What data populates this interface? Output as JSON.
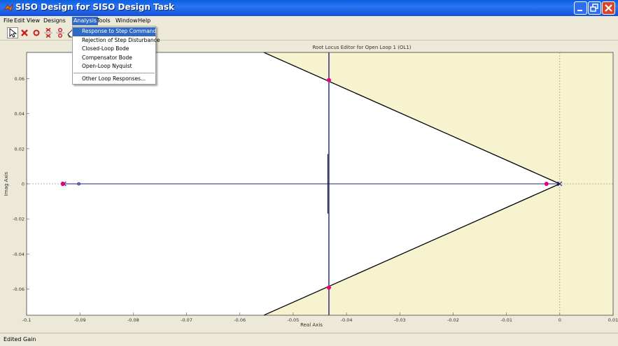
{
  "window": {
    "title": "SISO Design for SISO Design Task",
    "controls": [
      "minimize",
      "maximize",
      "close"
    ]
  },
  "menubar": {
    "items": [
      {
        "label": "File"
      },
      {
        "label": "Edit"
      },
      {
        "label": "View"
      },
      {
        "label": "Designs"
      },
      {
        "label": "Analysis",
        "active": true
      },
      {
        "label": "Tools"
      },
      {
        "label": "Window"
      },
      {
        "label": "Help"
      }
    ]
  },
  "toolbar": {
    "tools": [
      "pointer-icon",
      "add-pole-icon",
      "add-zero-icon",
      "add-complex-pole-icon",
      "add-complex-zero-icon",
      "eraser-icon"
    ]
  },
  "analysis_menu": {
    "items": [
      {
        "label": "Response to Step Command",
        "highlighted": true
      },
      {
        "label": "Rejection of Step Disturbance"
      },
      {
        "label": "Closed-Loop Bode"
      },
      {
        "label": "Compensator Bode"
      },
      {
        "label": "Open-Loop Nyquist"
      },
      {
        "label": "Other Loop Responses..."
      }
    ]
  },
  "colors": {
    "titlebar": "#1550d8",
    "highlight": "#316ac5",
    "shaded_region": "#f7f3ce",
    "locus_blue": "#1a237e",
    "closed_loop_pole": "#e6007e",
    "bound_line": "#000000"
  },
  "chart_data": {
    "type": "scatter",
    "title": "Root Locus Editor for Open Loop 1 (OL1)",
    "xlabel": "Real Axis",
    "ylabel": "Imag Axis",
    "xlim": [
      -0.1,
      0.01
    ],
    "ylim": [
      -0.075,
      0.075
    ],
    "xticks": [
      "-0.1",
      "-0.09",
      "-0.08",
      "-0.07",
      "-0.06",
      "-0.05",
      "-0.04",
      "-0.03",
      "-0.02",
      "-0.01",
      "0",
      "0.01"
    ],
    "yticks": [
      "0.06",
      "0.04",
      "0.02",
      "0",
      "-0.02",
      "-0.04",
      "-0.06"
    ],
    "xtick_values": [
      -0.1,
      -0.09,
      -0.08,
      -0.07,
      -0.06,
      -0.05,
      -0.04,
      -0.03,
      -0.02,
      -0.01,
      0,
      0.01
    ],
    "ytick_values": [
      0.06,
      0.04,
      0.02,
      0,
      -0.02,
      -0.04,
      -0.06
    ],
    "series": [
      {
        "values": [
          [
            -0.0932,
            0
          ],
          [
            -0.0025,
            0
          ],
          [
            -0.0433,
            0.0592
          ],
          [
            -0.0433,
            -0.0592
          ]
        ]
      }
    ],
    "open_loop_poles": [
      [
        -0.093,
        0
      ],
      [
        0,
        0
      ]
    ],
    "open_loop_zeros": [
      [
        -0.0902,
        0
      ]
    ],
    "locus_vertical_x": -0.0433,
    "damping_boundary_vertex": [
      0,
      0
    ],
    "damping_boundary_edge_x": -0.0555
  }
}
